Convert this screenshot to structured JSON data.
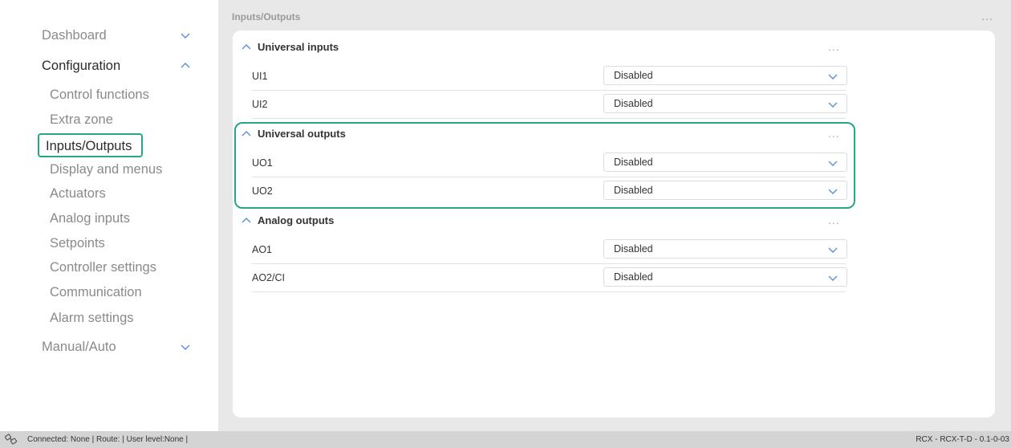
{
  "sidebar": {
    "items": [
      {
        "label": "Dashboard"
      },
      {
        "label": "Configuration"
      },
      {
        "label": "Control functions"
      },
      {
        "label": "Extra zone"
      },
      {
        "label": "Inputs/Outputs"
      },
      {
        "label": "Display and menus"
      },
      {
        "label": "Actuators"
      },
      {
        "label": "Analog inputs"
      },
      {
        "label": "Setpoints"
      },
      {
        "label": "Controller settings"
      },
      {
        "label": "Communication"
      },
      {
        "label": "Alarm settings"
      },
      {
        "label": "Manual/Auto"
      }
    ]
  },
  "main": {
    "title": "Inputs/Outputs",
    "more": "...",
    "sections": [
      {
        "title": "Universal inputs",
        "more": "...",
        "rows": [
          {
            "label": "UI1",
            "value": "Disabled"
          },
          {
            "label": "UI2",
            "value": "Disabled"
          }
        ]
      },
      {
        "title": "Universal outputs",
        "more": "...",
        "rows": [
          {
            "label": "UO1",
            "value": "Disabled"
          },
          {
            "label": "UO2",
            "value": "Disabled"
          }
        ]
      },
      {
        "title": "Analog outputs",
        "more": "...",
        "rows": [
          {
            "label": "AO1",
            "value": "Disabled"
          },
          {
            "label": "AO2/CI",
            "value": "Disabled"
          }
        ]
      }
    ]
  },
  "statusbar": {
    "text": "Connected: None | Route: | User level:None |",
    "version": "RCX - RCX-T-D - 0.1-0-03"
  },
  "colors": {
    "accent": "#26a58a",
    "chevron": "#5a8fd8"
  }
}
